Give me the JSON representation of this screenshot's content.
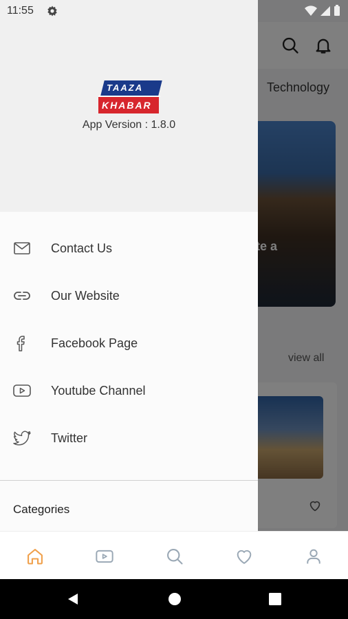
{
  "status_bar": {
    "time": "11:55"
  },
  "background": {
    "visible_tab": "Technology",
    "hero_text_fragment": "te a",
    "view_all": "view all"
  },
  "drawer": {
    "logo": {
      "line1": "TAAZA",
      "line2": "KHABAR"
    },
    "app_version": "App Version : 1.8.0",
    "menu": [
      {
        "label": "Contact Us",
        "icon": "mail-icon"
      },
      {
        "label": "Our Website",
        "icon": "link-icon"
      },
      {
        "label": "Facebook Page",
        "icon": "facebook-icon"
      },
      {
        "label": "Youtube Channel",
        "icon": "youtube-icon"
      },
      {
        "label": "Twitter",
        "icon": "twitter-icon"
      }
    ],
    "categories_label": "Categories"
  },
  "bottom_nav": [
    {
      "name": "home",
      "icon": "home-icon",
      "active": true
    },
    {
      "name": "video",
      "icon": "video-icon",
      "active": false
    },
    {
      "name": "search",
      "icon": "search-icon",
      "active": false
    },
    {
      "name": "favorites",
      "icon": "heart-icon",
      "active": false
    },
    {
      "name": "profile",
      "icon": "user-icon",
      "active": false
    }
  ],
  "colors": {
    "accent": "#f0a04b",
    "icon_inactive": "#9aa8b5",
    "logo_blue": "#1a3a8a",
    "logo_red": "#d7262d",
    "text_primary": "#333333"
  }
}
